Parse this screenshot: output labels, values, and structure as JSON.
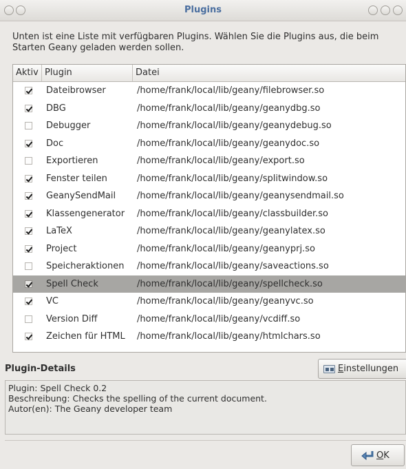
{
  "window": {
    "title": "Plugins"
  },
  "intro": "Unten ist eine Liste mit verfügbaren Plugins. Wählen Sie die Plugins aus, die beim Starten Geany geladen werden sollen.",
  "table": {
    "columns": [
      "Aktiv",
      "Plugin",
      "Datei"
    ],
    "rows": [
      {
        "active": true,
        "plugin": "Dateibrowser",
        "file": "/home/frank/local/lib/geany/filebrowser.so"
      },
      {
        "active": true,
        "plugin": "DBG",
        "file": "/home/frank/local/lib/geany/geanydbg.so"
      },
      {
        "active": false,
        "plugin": "Debugger",
        "file": "/home/frank/local/lib/geany/geanydebug.so"
      },
      {
        "active": true,
        "plugin": "Doc",
        "file": "/home/frank/local/lib/geany/geanydoc.so"
      },
      {
        "active": false,
        "plugin": "Exportieren",
        "file": "/home/frank/local/lib/geany/export.so"
      },
      {
        "active": true,
        "plugin": "Fenster teilen",
        "file": "/home/frank/local/lib/geany/splitwindow.so"
      },
      {
        "active": true,
        "plugin": "GeanySendMail",
        "file": "/home/frank/local/lib/geany/geanysendmail.so"
      },
      {
        "active": true,
        "plugin": "Klassengenerator",
        "file": "/home/frank/local/lib/geany/classbuilder.so"
      },
      {
        "active": true,
        "plugin": "LaTeX",
        "file": "/home/frank/local/lib/geany/geanylatex.so"
      },
      {
        "active": true,
        "plugin": "Project",
        "file": "/home/frank/local/lib/geany/geanyprj.so"
      },
      {
        "active": false,
        "plugin": "Speicheraktionen",
        "file": "/home/frank/local/lib/geany/saveactions.so"
      },
      {
        "active": true,
        "plugin": "Spell Check",
        "file": "/home/frank/local/lib/geany/spellcheck.so",
        "selected": true
      },
      {
        "active": true,
        "plugin": "VC",
        "file": "/home/frank/local/lib/geany/geanyvc.so"
      },
      {
        "active": false,
        "plugin": "Version Diff",
        "file": "/home/frank/local/lib/geany/vcdiff.so"
      },
      {
        "active": true,
        "plugin": "Zeichen für HTML",
        "file": "/home/frank/local/lib/geany/htmlchars.so"
      }
    ]
  },
  "details": {
    "label": "Plugin-Details",
    "settings_button": "Einstellungen",
    "plugin_line": "Plugin: Spell Check 0.2",
    "description_line": "Beschreibung: Checks the spelling of the current document.",
    "author_line": "Autor(en): The Geany developer team"
  },
  "ok_button": "OK",
  "colors": {
    "title": "#4a6e9f",
    "selected_row": "#a7a6a3"
  },
  "icons": [
    "window-button-icon",
    "checkbox-icon",
    "settings-icon",
    "ok-icon"
  ]
}
